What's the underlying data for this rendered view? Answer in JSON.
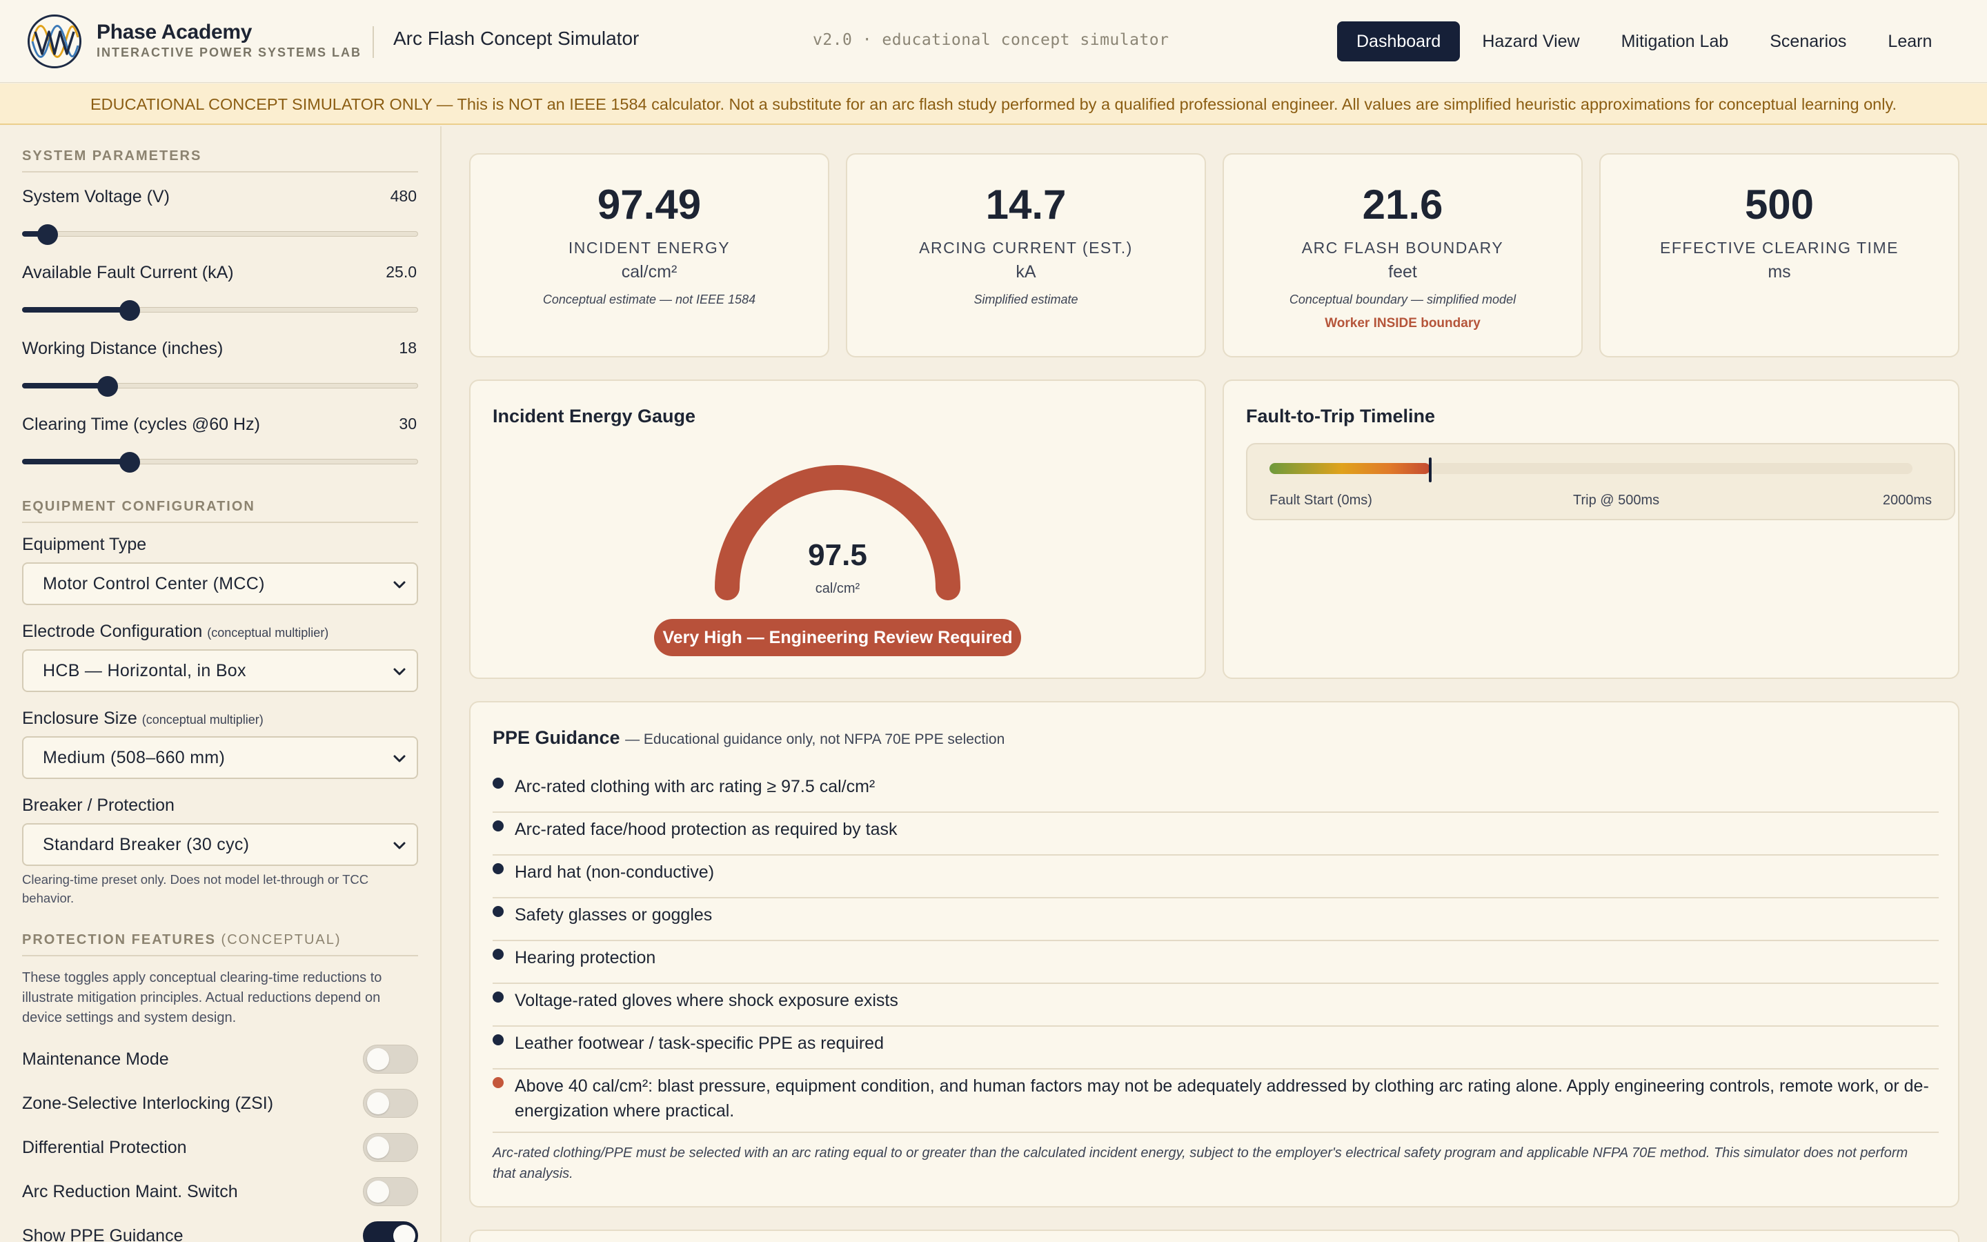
{
  "header": {
    "brand_name": "Phase Academy",
    "brand_sub": "INTERACTIVE POWER SYSTEMS LAB",
    "app_title": "Arc Flash Concept Simulator",
    "version": "v2.0 · educational concept simulator",
    "nav": [
      {
        "label": "Dashboard",
        "active": true
      },
      {
        "label": "Hazard View",
        "active": false
      },
      {
        "label": "Mitigation Lab",
        "active": false
      },
      {
        "label": "Scenarios",
        "active": false
      },
      {
        "label": "Learn",
        "active": false
      }
    ]
  },
  "banner": "EDUCATIONAL CONCEPT SIMULATOR ONLY — This is NOT an IEEE 1584 calculator. Not a substitute for an arc flash study performed by a qualified professional engineer. All values are simplified heuristic approximations for conceptual learning only.",
  "sidebar": {
    "system_title": "SYSTEM PARAMETERS",
    "params": [
      {
        "label": "System Voltage (V)",
        "value": "480",
        "fraction": 0.04
      },
      {
        "label": "Available Fault Current (kA)",
        "value": "25.0",
        "fraction": 0.26
      },
      {
        "label": "Working Distance (inches)",
        "value": "18",
        "fraction": 0.2
      },
      {
        "label": "Clearing Time (cycles @60 Hz)",
        "value": "30",
        "fraction": 0.26
      }
    ],
    "equip_title": "EQUIPMENT CONFIGURATION",
    "equipment_type": {
      "label": "Equipment Type",
      "value": "Motor Control Center (MCC)"
    },
    "electrode": {
      "label": "Electrode Configuration",
      "hint": "(conceptual multiplier)",
      "value": "HCB — Horizontal, in Box"
    },
    "enclosure": {
      "label": "Enclosure Size",
      "hint": "(conceptual multiplier)",
      "value": "Medium (508–660 mm)"
    },
    "breaker": {
      "label": "Breaker / Protection",
      "value": "Standard Breaker (30 cyc)"
    },
    "breaker_note": "Clearing-time preset only. Does not model let-through or TCC behavior.",
    "prot_title": "PROTECTION FEATURES",
    "prot_title_suffix": "(CONCEPTUAL)",
    "prot_note": "These toggles apply conceptual clearing-time reductions to illustrate mitigation principles. Actual reductions depend on device settings and system design.",
    "toggles": [
      {
        "label": "Maintenance Mode",
        "on": false
      },
      {
        "label": "Zone-Selective Interlocking (ZSI)",
        "on": false
      },
      {
        "label": "Differential Protection",
        "on": false
      },
      {
        "label": "Arc Reduction Maint. Switch",
        "on": false
      },
      {
        "label": "Show PPE Guidance",
        "on": true
      }
    ]
  },
  "kpis": [
    {
      "value": "97.49",
      "label": "INCIDENT ENERGY",
      "unit": "cal/cm²",
      "note": "Conceptual estimate — not IEEE 1584",
      "warn": ""
    },
    {
      "value": "14.7",
      "label": "ARCING CURRENT (EST.)",
      "unit": "kA",
      "note": "Simplified estimate",
      "warn": ""
    },
    {
      "value": "21.6",
      "label": "ARC FLASH BOUNDARY",
      "unit": "feet",
      "note": "Conceptual boundary — simplified model",
      "warn": "Worker INSIDE boundary"
    },
    {
      "value": "500",
      "label": "EFFECTIVE CLEARING TIME",
      "unit": "ms",
      "note": "",
      "warn": ""
    }
  ],
  "gauge": {
    "title": "Incident Energy Gauge",
    "value": "97.5",
    "unit": "cal/cm²",
    "badge": "Very High — Engineering Review Required",
    "fill_fraction": 1.0,
    "color": "#b8513a"
  },
  "timeline": {
    "title": "Fault-to-Trip Timeline",
    "label_start": "Fault Start (0ms)",
    "label_trip": "Trip @ 500ms",
    "label_end": "2000ms",
    "trip_fraction": 0.25
  },
  "ppe": {
    "title": "PPE Guidance",
    "subtitle": "— Educational guidance only, not NFPA 70E PPE selection",
    "items": [
      {
        "text": "Arc-rated clothing with arc rating ≥ 97.5 cal/cm²",
        "warn": false
      },
      {
        "text": "Arc-rated face/hood protection as required by task",
        "warn": false
      },
      {
        "text": "Hard hat (non-conductive)",
        "warn": false
      },
      {
        "text": "Safety glasses or goggles",
        "warn": false
      },
      {
        "text": "Hearing protection",
        "warn": false
      },
      {
        "text": "Voltage-rated gloves where shock exposure exists",
        "warn": false
      },
      {
        "text": "Leather footwear / task-specific PPE as required",
        "warn": false
      },
      {
        "text": "Above 40 cal/cm²: blast pressure, equipment condition, and human factors may not be adequately addressed by clothing arc rating alone. Apply engineering controls, remote work, or de-energization where practical.",
        "warn": true
      }
    ],
    "footnote": "Arc-rated clothing/PPE must be selected with an arc rating equal to or greater than the calculated incident energy, subject to the employer's electrical safety program and applicable NFPA 70E method. This simulator does not perform that analysis."
  }
}
